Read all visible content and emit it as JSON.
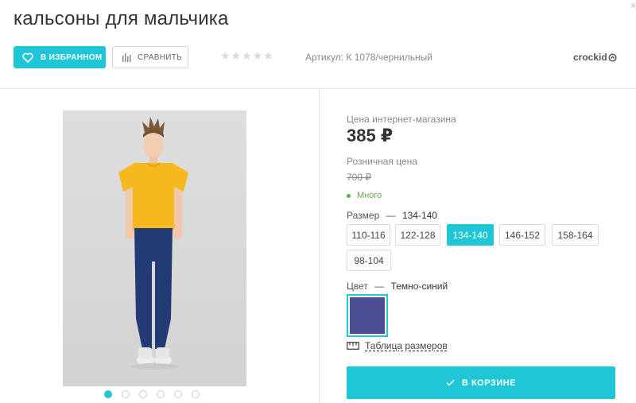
{
  "product": {
    "title": "кальсоны для мальчика",
    "article": "Артикул: К 1078/чернильный",
    "brand": "crockid",
    "rating_stars": 5,
    "rating_value": 0
  },
  "actions": {
    "favorite_label": "В ИЗБРАННОМ",
    "compare_label": "СРАВНИТЬ"
  },
  "pricing": {
    "online_label": "Цена интернет-магазина",
    "online_price": "385 ₽",
    "retail_label": "Розничная цена",
    "retail_price": "700 ₽",
    "stock_status": "Много"
  },
  "size": {
    "label": "Размер",
    "dash": "—",
    "selected": "134-140",
    "options": [
      "110-116",
      "122-128",
      "134-140",
      "146-152",
      "158-164",
      "98-104"
    ]
  },
  "color": {
    "label": "Цвет",
    "dash": "—",
    "selected": "Темно-синий",
    "swatch_hex": "#4a4e92"
  },
  "size_table_label": "Таблица размеров",
  "cart_label": "В КОРЗИНЕ",
  "gallery": {
    "dots": 6,
    "active_index": 0
  },
  "colors": {
    "accent": "#1fc6d6",
    "stock_green": "#55b33f"
  }
}
